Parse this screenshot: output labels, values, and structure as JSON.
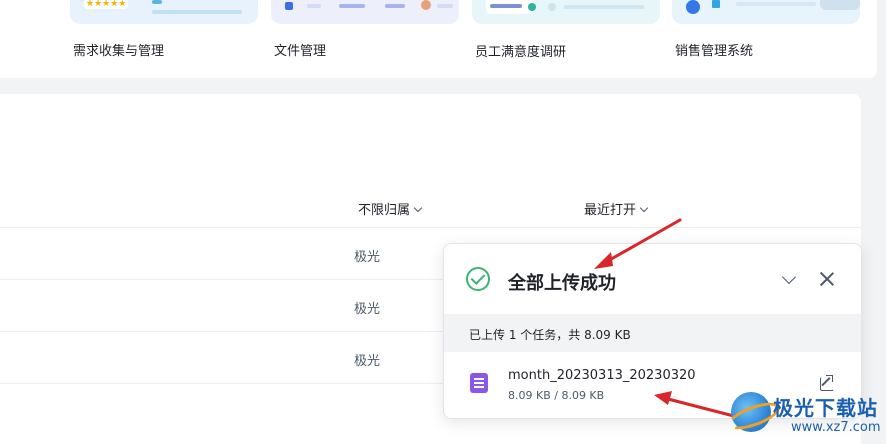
{
  "templates": [
    {
      "label": "需求收集与管理",
      "thumb_icon": "rating-stars-icon"
    },
    {
      "label": "文件管理",
      "thumb_icon": "folder-flow-icon"
    },
    {
      "label": "员工满意度调研",
      "thumb_icon": "survey-form-icon"
    },
    {
      "label": "销售管理系统",
      "thumb_icon": "sales-board-icon"
    }
  ],
  "table": {
    "filter_owner_label": "不限归属",
    "sort_label": "最近打开",
    "rows": [
      {
        "owner": "极光"
      },
      {
        "owner": "极光"
      },
      {
        "owner": "极光"
      }
    ]
  },
  "upload_popup": {
    "title": "全部上传成功",
    "summary": "已上传 1 个任务，共 8.09 KB",
    "file": {
      "name": "month_20230313_20230320",
      "progress": "8.09 KB / 8.09 KB",
      "icon": "sheet-file-icon"
    },
    "colors": {
      "success": "#3cb371",
      "file_icon": "#8a57e6"
    }
  },
  "annotation_color": "#d9262a",
  "watermark": {
    "title": "极光下载站",
    "url": "www.xz7.com"
  }
}
